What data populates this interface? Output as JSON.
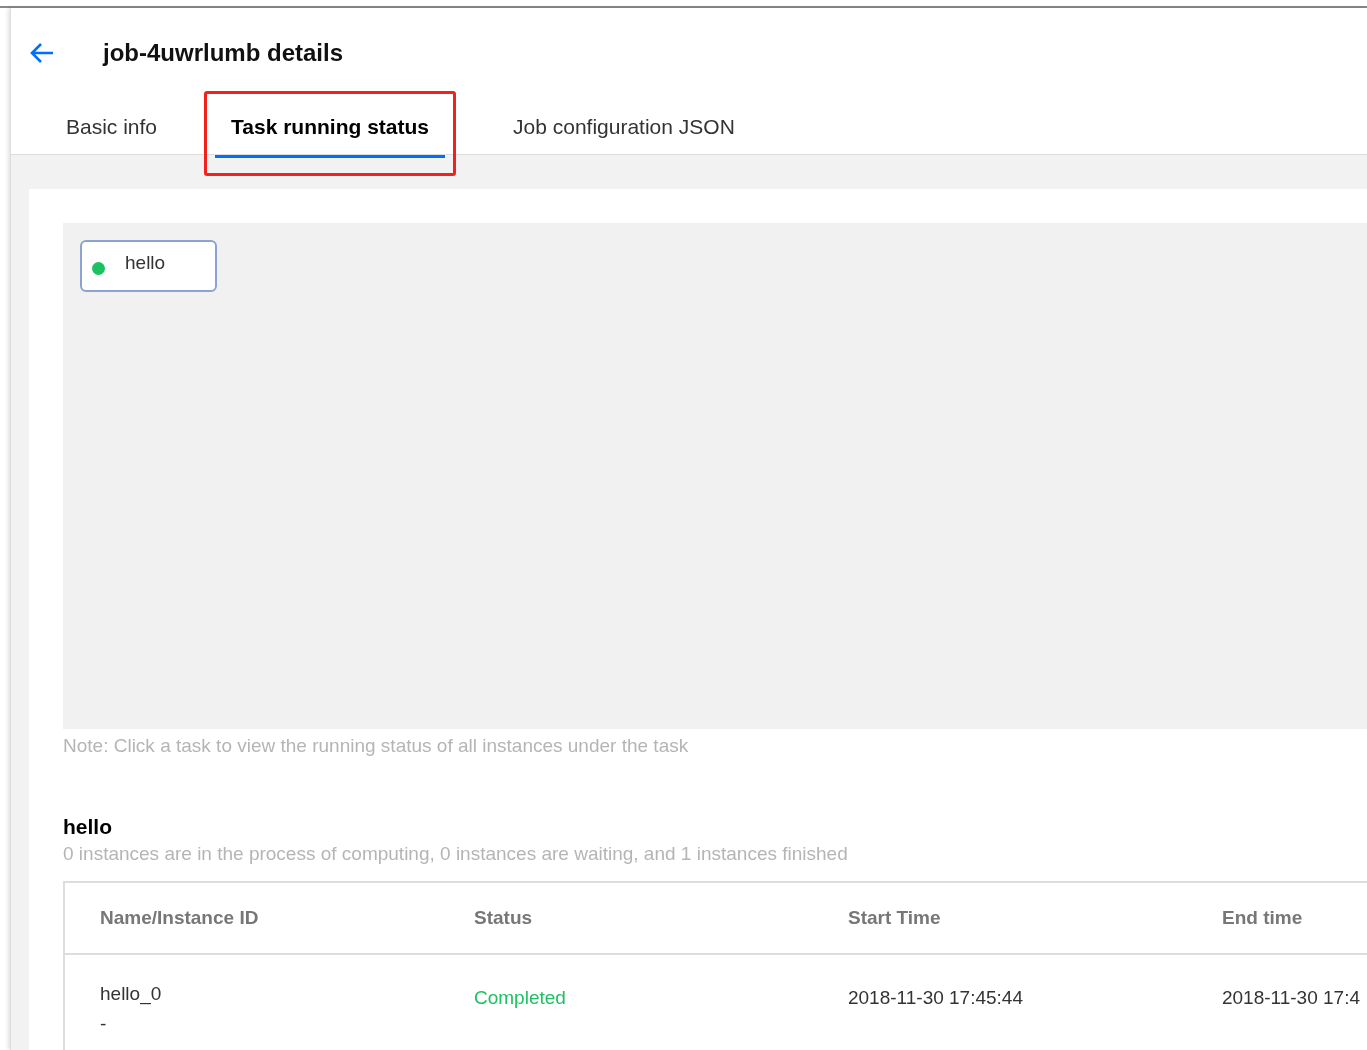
{
  "header": {
    "title": "job-4uwrlumb details"
  },
  "tabs": [
    {
      "label": "Basic info",
      "selected": false,
      "highlighted": false
    },
    {
      "label": "Task running status",
      "selected": true,
      "highlighted": true
    },
    {
      "label": "Job configuration JSON",
      "selected": false,
      "highlighted": false
    }
  ],
  "canvas": {
    "nodes": [
      {
        "label": "hello",
        "color": "#1ec162"
      }
    ],
    "note": "Note: Click a task to view the running status of all instances under the task"
  },
  "task": {
    "name": "hello",
    "summary": "0 instances are in the process of computing, 0 instances are waiting, and 1 instances finished"
  },
  "table": {
    "columns": [
      "Name/Instance ID",
      "Status",
      "Start Time",
      "End time"
    ],
    "rows": [
      {
        "name": "hello_0",
        "instance_id": "-",
        "status": "Completed",
        "color": "#1ec162",
        "start_time": "2018-11-30 17:45:44",
        "end_time": "2018-11-30 17:4"
      }
    ]
  }
}
